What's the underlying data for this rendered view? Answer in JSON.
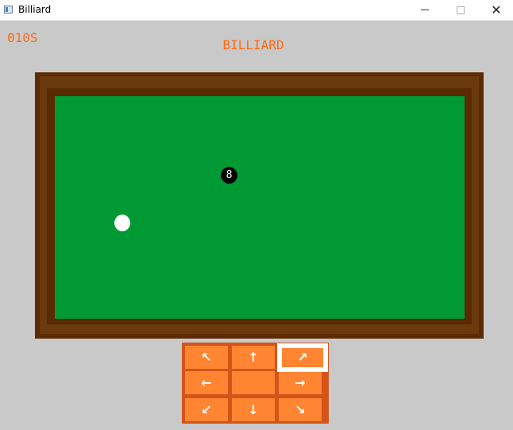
{
  "window": {
    "title": "Billiard",
    "controls": {
      "minimize": "—",
      "maximize": "☐",
      "close": "✕"
    }
  },
  "game": {
    "timer": "010S",
    "title": "BILLIARD"
  },
  "balls": {
    "eight": {
      "label": "8",
      "color": "#000000"
    },
    "cue": {
      "color": "#ffffff"
    }
  },
  "colors": {
    "background": "#c9c9c9",
    "felt": "#009933",
    "frame": "#5e2a04",
    "accent": "#ff6a13",
    "button": "#ff8533",
    "button_border": "#d4541a"
  },
  "controls": {
    "selected": "up-right",
    "buttons": [
      {
        "id": "up-left",
        "glyph": "↖"
      },
      {
        "id": "up",
        "glyph": "↑"
      },
      {
        "id": "up-right",
        "glyph": "↗"
      },
      {
        "id": "left",
        "glyph": "←"
      },
      {
        "id": "center",
        "glyph": ""
      },
      {
        "id": "right",
        "glyph": "→"
      },
      {
        "id": "down-left",
        "glyph": "↙"
      },
      {
        "id": "down",
        "glyph": "↓"
      },
      {
        "id": "down-right",
        "glyph": "↘"
      }
    ]
  }
}
